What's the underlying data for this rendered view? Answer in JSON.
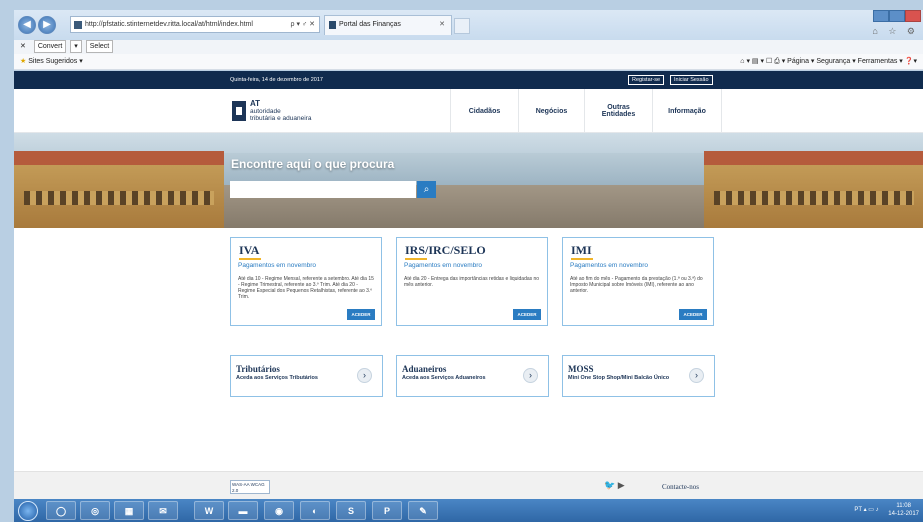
{
  "browser": {
    "url": "http://pfstatic.stinternetdev.ritta.local/at/html/index.html",
    "url_controls": "ρ ▾ ♂ ✕",
    "tab_title": "Portal das Finanças",
    "tab_close": "✕",
    "back": "◀",
    "forward": "▶"
  },
  "command_bar": {
    "close": "✕",
    "convert": "Convert",
    "select": "Select"
  },
  "favorites_bar": {
    "suggested": "Sites Sugeridos ▾",
    "page": "Página ▾",
    "security": "Segurança ▾",
    "tools": "Ferramentas ▾"
  },
  "top_band": {
    "date": "Quinta-feira, 14 de dezembro de 2017",
    "register": "Registar-se",
    "login": "Iniciar Sessão"
  },
  "logo": {
    "line1": "AT",
    "line2": "autoridade",
    "line3": "tributária e aduaneira"
  },
  "menu": [
    {
      "label": "Cidadãos"
    },
    {
      "label": "Negócios"
    },
    {
      "label": "Outras Entidades"
    },
    {
      "label": "Informação"
    }
  ],
  "hero": {
    "title": "Encontre aqui o que procura",
    "search_placeholder": ""
  },
  "cards": [
    {
      "title": "IVA",
      "subtitle": "Pagamentos em novembro",
      "text": "Até dia 10 - Regime Mensal, referente a setembro. Até dia 15 - Regime Trimestral, referente ao 3.º Trim. Até dia 20 - Regime Especial dos Pequenos Retalhistas, referente ao 3.º Trim.",
      "button": "ACEDER"
    },
    {
      "title": "IRS/IRC/SELO",
      "subtitle": "Pagamentos em novembro",
      "text": "Até dia 20 - Entrega das importâncias retidas e liquidadas no mês anterior.",
      "button": "ACEDER"
    },
    {
      "title": "IMI",
      "subtitle": "Pagamentos em novembro",
      "text": "Até ao fim do mês - Pagamento da prestação (1.ª ou 3.ª) do Imposto Municipal sobre Imóveis (IMI), referente ao ano anterior.",
      "button": "ACEDER"
    }
  ],
  "services": [
    {
      "title": "Tributários",
      "subtitle": "Aceda aos Serviços Tributários",
      "arrow": "›"
    },
    {
      "title": "Aduaneiros",
      "subtitle": "Aceda aos Serviços Aduaneiros",
      "arrow": "›"
    },
    {
      "title": "MOSS",
      "subtitle": "Mini One Stop Shop/Mini Balcão Único",
      "arrow": "›"
    }
  ],
  "footer": {
    "badge": "WAS-AA WCAG 2.0",
    "social": "🐦 ▶",
    "contact": "Contacte-nos"
  },
  "taskbar": {
    "apps": [
      "◯",
      "◎",
      "▦",
      "✉",
      "W",
      "▬",
      "◉",
      "◐",
      "S",
      "P",
      "✎"
    ],
    "lang": "PT",
    "time": "11:08",
    "date": "14-12-2017"
  }
}
